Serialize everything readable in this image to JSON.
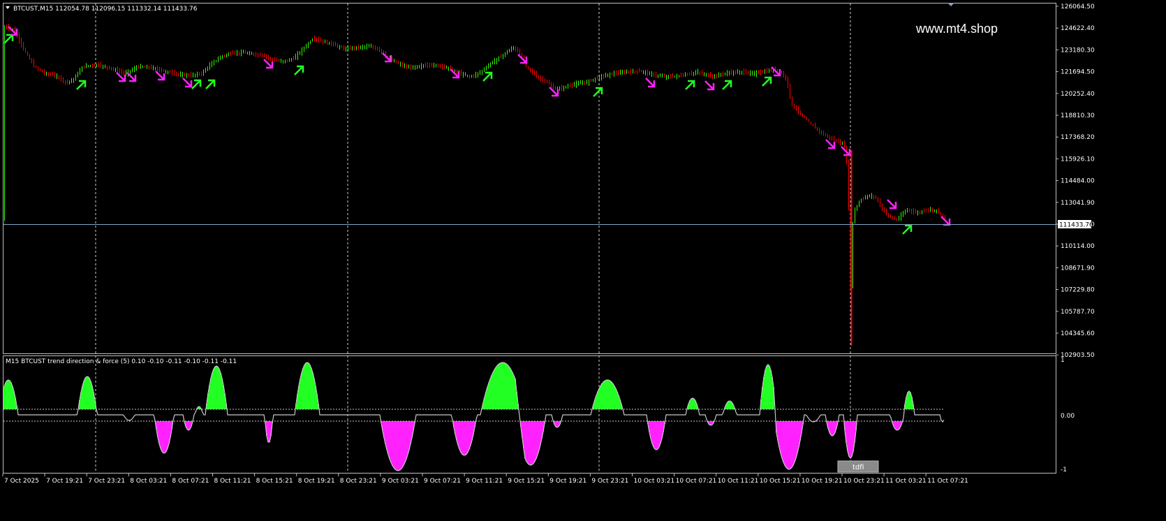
{
  "main_chart": {
    "header_text": "BTCUST,M15  112054.78 112096.15 111332.14 111433.76",
    "watermark": "www.mt4.shop",
    "price_levels": [
      "126064.50",
      "124622.40",
      "123180.30",
      "121694.50",
      "120252.40",
      "118810.30",
      "117368.20",
      "115926.10",
      "114484.00",
      "113041.90",
      "111599.80",
      "110114.00",
      "108671.90",
      "107229.80",
      "105787.70",
      "104345.60",
      "102903.50"
    ],
    "current_price_label": "111433.76",
    "colors": {
      "bull": "#33ff00",
      "bear": "#ff0000",
      "buy_arrow": "#22ff22",
      "sell_arrow": "#ff22ff",
      "current_line": "#7fa7c9"
    }
  },
  "indicator": {
    "header_text": "M15 BTCUST trend direction & force (5) 0.10 -0.10 -0.11 -0.10 -0.11 -0.11",
    "levels": [
      "1",
      "0.00",
      "-1"
    ],
    "tab_label": "tdfi"
  },
  "time_axis": {
    "labels": [
      "7 Oct 2025",
      "7 Oct 19:21",
      "7 Oct 23:21",
      "8 Oct 03:21",
      "8 Oct 07:21",
      "8 Oct 11:21",
      "8 Oct 15:21",
      "8 Oct 19:21",
      "8 Oct 23:21",
      "9 Oct 03:21",
      "9 Oct 07:21",
      "9 Oct 11:21",
      "9 Oct 15:21",
      "9 Oct 19:21",
      "9 Oct 23:21",
      "10 Oct 03:21",
      "10 Oct 07:21",
      "10 Oct 11:21",
      "10 Oct 15:21",
      "10 Oct 19:21",
      "10 Oct 23:21",
      "11 Oct 03:21",
      "11 Oct 07:21"
    ]
  }
}
